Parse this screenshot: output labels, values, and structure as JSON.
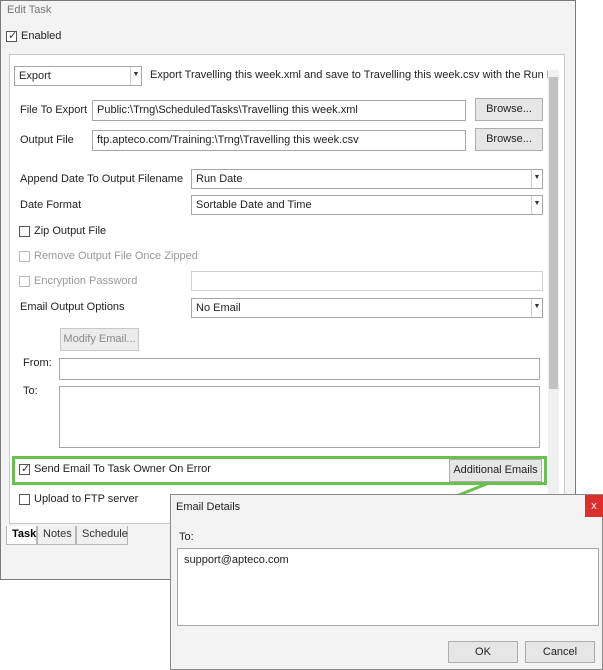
{
  "window": {
    "title": "Edit Task"
  },
  "enabled": {
    "label": "Enabled",
    "checked": true
  },
  "task_type": {
    "value": "Export",
    "summary": "Export Travelling this week.xml and save to Travelling this week.csv with the Run D..."
  },
  "file_to_export": {
    "label": "File To Export",
    "value": "Public:\\Trng\\ScheduledTasks\\Travelling this week.xml",
    "browse": "Browse..."
  },
  "output_file": {
    "label": "Output File",
    "value": "ftp.apteco.com/Training:\\Trng\\Travelling this week.csv",
    "browse": "Browse..."
  },
  "append_date": {
    "label": "Append Date To Output Filename",
    "value": "Run Date"
  },
  "date_format": {
    "label": "Date Format",
    "value": "Sortable Date and Time"
  },
  "zip_output": {
    "label": "Zip Output File",
    "checked": false
  },
  "remove_output": {
    "label": "Remove Output File Once Zipped",
    "checked": false
  },
  "encryption": {
    "label": "Encryption Password",
    "checked": false,
    "value": ""
  },
  "email_options": {
    "label": "Email Output Options",
    "value": "No Email"
  },
  "modify_email": {
    "label": "Modify Email..."
  },
  "from": {
    "label": "From:",
    "value": ""
  },
  "to": {
    "label": "To:",
    "value": ""
  },
  "send_on_error": {
    "label": "Send Email To Task Owner On Error",
    "checked": true,
    "additional": "Additional Emails"
  },
  "upload_ftp": {
    "label": "Upload to FTP server",
    "checked": false
  },
  "tabs": [
    {
      "label": "Task"
    },
    {
      "label": "Notes"
    },
    {
      "label": "Schedule"
    }
  ],
  "dialog": {
    "title": "Email Details",
    "close": "x",
    "to_label": "To:",
    "to_value": "support@apteco.com",
    "ok": "OK",
    "cancel": "Cancel"
  },
  "colors": {
    "highlight": "#6bbf4e",
    "close": "#d9302c"
  },
  "icons": {
    "check": "checkmark-icon",
    "dropdown": "dropdown-arrow-icon",
    "close": "close-icon"
  }
}
